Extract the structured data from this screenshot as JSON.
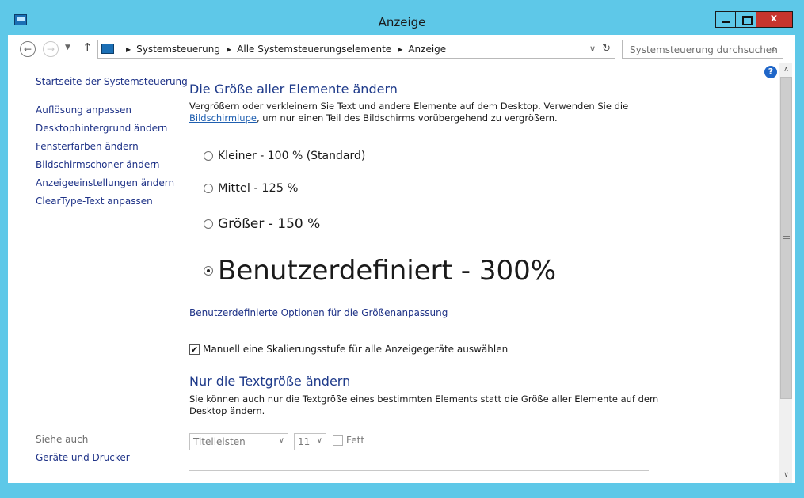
{
  "window": {
    "title": "Anzeige",
    "close_label": "x"
  },
  "navbar": {
    "breadcrumbs": [
      "Systemsteuerung",
      "Alle Systemsteuerungselemente",
      "Anzeige"
    ],
    "search_placeholder": "Systemsteuerung durchsuchen"
  },
  "sidebar": {
    "home": "Startseite der Systemsteuerung",
    "items": [
      "Auflösung anpassen",
      "Desktophintergrund ändern",
      "Fensterfarben ändern",
      "Bildschirmschoner ändern",
      "Anzeigeeinstellungen ändern",
      "ClearType-Text anpassen"
    ],
    "see_also_title": "Siehe auch",
    "see_also_items": [
      "Geräte und Drucker"
    ]
  },
  "main": {
    "heading": "Die Größe aller Elemente ändern",
    "desc_line1": "Vergrößern oder verkleinern Sie Text und andere Elemente auf dem Desktop. Verwenden Sie die",
    "desc_link": "Bildschirmlupe",
    "desc_line2_rest": ", um nur einen Teil des Bildschirms vorübergehend zu vergrößern.",
    "options": [
      {
        "label": "Kleiner - 100 % (Standard)",
        "checked": false
      },
      {
        "label": "Mittel - 125 %",
        "checked": false
      },
      {
        "label": "Größer - 150 %",
        "checked": false
      },
      {
        "label": "Benutzerdefiniert - 300%",
        "checked": true
      }
    ],
    "custom_options_link": "Benutzerdefinierte Optionen für die Größenanpassung",
    "manual_checkbox_label": "Manuell eine Skalierungsstufe für alle Anzeigegeräte auswählen",
    "manual_checked": true,
    "heading2": "Nur die Textgröße ändern",
    "desc2_line1": "Sie können auch nur die Textgröße eines bestimmten Elements statt die Größe aller Elemente auf dem",
    "desc2_line2": "Desktop ändern.",
    "element_select_value": "Titelleisten",
    "size_select_value": "11",
    "bold_label": "Fett",
    "bold_checked": false
  },
  "colors": {
    "frame": "#5ec8e8",
    "close_button": "#c7352e",
    "heading": "#1e3a8a",
    "link": "#1e3287"
  }
}
